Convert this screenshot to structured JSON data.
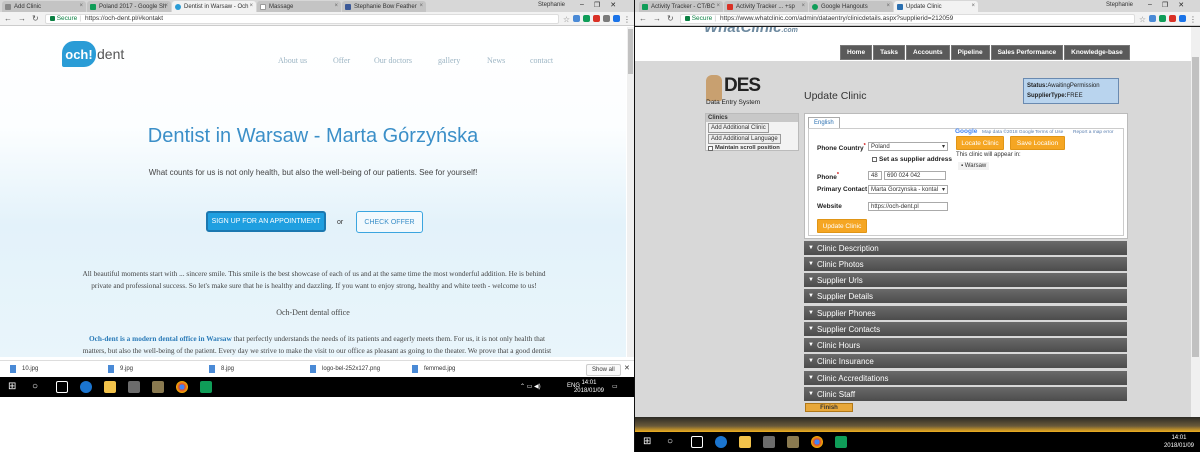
{
  "left": {
    "tabs": [
      {
        "label": "Add Clinic",
        "active": false,
        "color": "#888888"
      },
      {
        "label": "Poland 2017 - Google Sh",
        "active": false,
        "color": "#0f9d58"
      },
      {
        "label": "Dentist in Warsaw - Och",
        "active": true,
        "color": "#2a9cd6"
      },
      {
        "label": "Massage",
        "active": false,
        "color": "#999999"
      },
      {
        "label": "Stephanie Bow Feather",
        "active": false,
        "color": "#3b5998"
      }
    ],
    "profile": "Stephanie",
    "secure_label": "Secure",
    "url": "https://och-dent.pl/#kontakt",
    "site": {
      "logo": {
        "badge": "och!",
        "text": "dent"
      },
      "menu": [
        "About us",
        "Offer",
        "Our doctors",
        "gallery",
        "News",
        "contact"
      ],
      "hero_title": "Dentist in Warsaw - Marta Górzyńska",
      "hero_sub": "What counts for us is not only health, but also the well-being of our patients. See for yourself!",
      "signup_button": "SIGN UP FOR AN APPOINTMENT",
      "or_label": "or",
      "check_button": "CHECK OFFER",
      "para_line1": "All beautiful moments start with ... sincere smile. This smile is the best showcase of each of us and at the same time the most wonderful addition. He is behind",
      "para_line2": "private and professional success. So let's make sure that he is healthy and dazzling. If you want to enjoy strong, healthy and white teeth - welcome to us!",
      "dental_office": "Och-Dent dental office",
      "para2_bold": "Och-dent is a modern dental office in Warsaw",
      "para2_rest1": " that perfectly understands the needs of its patients and eagerly meets them. For us, it is not only health that",
      "para2_line2": "matters, but also the well-being of the patient. Every day we strive to make the visit to our office as pleasant as going to the theater. We prove that a good dentist"
    },
    "downloads": [
      "10.jpg",
      "9.jpg",
      "8.jpg",
      "logo-bel-252x127.png",
      "femmed.jpg"
    ],
    "show_all": "Show all",
    "tray": {
      "lang": "ENG",
      "time": "14:01",
      "date": "2018/01/09"
    }
  },
  "right": {
    "tabs": [
      {
        "label": "Activity Tracker - CT/BC",
        "active": false,
        "color": "#0f9d58"
      },
      {
        "label": "Activity Tracker ... +sp",
        "active": false,
        "color": "#d93025"
      },
      {
        "label": "Google Hangouts",
        "active": false,
        "color": "#0f9d58"
      },
      {
        "label": "Update Clinic",
        "active": true,
        "color": "#2a6fb0"
      }
    ],
    "profile": "Stephanie",
    "secure_label": "Secure",
    "url": "https://www.whatclinic.com/admin/dataentry/clinicdetails.aspx?supplierid=212059",
    "logo": {
      "main": "WhatClinic",
      "suffix": ".com"
    },
    "nav": [
      "Home",
      "Tasks",
      "Accounts",
      "Pipeline",
      "Sales Performance",
      "Knowledge-base"
    ],
    "des": {
      "title": "DES",
      "sub": "Data Entry System"
    },
    "page_title": "Update Clinic",
    "status": {
      "status_label": "Status:",
      "status_value": "AwaitingPermission",
      "type_label": "SupplierType:",
      "type_value": "FREE"
    },
    "clinics": {
      "header": "Clinics",
      "add_clinic": "Add Additional Clinic",
      "add_language": "Add Additional Language",
      "maintain_scroll": "Maintain scroll position"
    },
    "form": {
      "lang_tab": "English",
      "phone_country_label": "Phone Country",
      "phone_country_value": "Poland",
      "set_supplier": "Set as supplier address",
      "phone_label": "Phone",
      "phone_code": "48",
      "phone_number": "690 024 042",
      "primary_contact_label": "Primary Contact",
      "primary_contact_value": "Marta Gorzynska - kontal",
      "website_label": "Website",
      "website_value": "https://och-dent.pl",
      "update_button": "Update Clinic",
      "locate_button": "Locate Clinic",
      "save_location_button": "Save Location",
      "map_google": "Google",
      "map_data": "Map data ©2018 Google",
      "map_terms": "Terms of Use",
      "map_report": "Report a map error",
      "appear_label": "This clinic will appear in:",
      "city": "Warsaw"
    },
    "sections": [
      "Clinic Description",
      "Clinic Photos",
      "Supplier Urls",
      "Supplier Details",
      "Supplier Phones",
      "Supplier Contacts",
      "Clinic Hours",
      "Clinic Insurance",
      "Clinic Accreditations",
      "Clinic Staff"
    ],
    "finish_button": "Finish",
    "tray": {
      "time": "14:01",
      "date": "2018/01/09"
    }
  }
}
